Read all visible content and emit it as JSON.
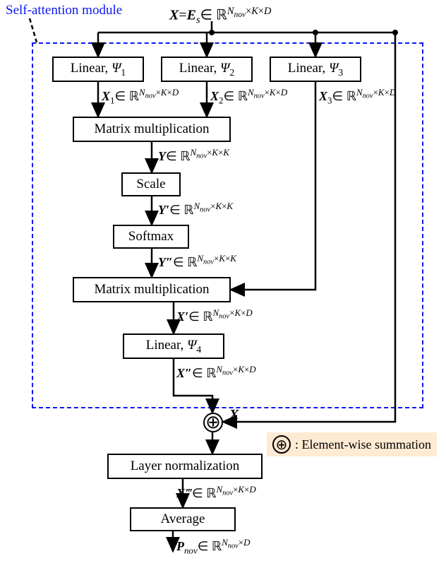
{
  "module_title": "Self-attention module",
  "input": {
    "lhs": "X",
    "rhs_var": "E",
    "rhs_sub": "s",
    "dims_sup": "N_nov×K×D"
  },
  "linear1": {
    "label_prefix": "Linear, ",
    "psi": "Ψ",
    "idx": "1"
  },
  "linear2": {
    "label_prefix": "Linear, ",
    "psi": "Ψ",
    "idx": "2"
  },
  "linear3": {
    "label_prefix": "Linear, ",
    "psi": "Ψ",
    "idx": "3"
  },
  "x1": {
    "var": "X",
    "idx": "1",
    "dims_sup": "N_nov×K×D"
  },
  "x2": {
    "var": "X",
    "idx": "2",
    "dims_sup": "N_nov×K×D"
  },
  "x3": {
    "var": "X",
    "idx": "3",
    "dims_sup": "N_nov×K×D"
  },
  "matmul1": "Matrix multiplication",
  "y": {
    "var": "Y",
    "dims_sup": "N_nov×K×K"
  },
  "scale": "Scale",
  "yp": {
    "var": "Y′",
    "dims_sup": "N_nov×K×K"
  },
  "softmax": "Softmax",
  "ypp": {
    "var": "Y″",
    "dims_sup": "N_nov×K×K"
  },
  "matmul2": "Matrix multiplication",
  "xp": {
    "var": "X′",
    "dims_sup": "N_nov×K×D"
  },
  "linear4": {
    "label_prefix": "Linear, ",
    "psi": "Ψ",
    "idx": "4"
  },
  "xpp": {
    "var": "X″",
    "dims_sup": "N_nov×K×D"
  },
  "residual_var": "X",
  "layernorm": "Layer normalization",
  "xppp": {
    "var": "X‴",
    "dims_sup": "N_nov×K×D"
  },
  "average": "Average",
  "output": {
    "var": "P",
    "sub_prefix": "nov",
    "dims_sup": "N_nov×D"
  },
  "legend": "Element-wise summation",
  "chart_data": {
    "type": "diagram",
    "title": "Self-attention module flow",
    "nodes": [
      {
        "id": "in",
        "label": "X = E_s ∈ ℝ^{N_nov×K×D}",
        "kind": "input"
      },
      {
        "id": "L1",
        "label": "Linear, Ψ1",
        "out": "X1 ∈ ℝ^{N_nov×K×D}"
      },
      {
        "id": "L2",
        "label": "Linear, Ψ2",
        "out": "X2 ∈ ℝ^{N_nov×K×D}"
      },
      {
        "id": "L3",
        "label": "Linear, Ψ3",
        "out": "X3 ∈ ℝ^{N_nov×K×D}"
      },
      {
        "id": "MM1",
        "label": "Matrix multiplication",
        "out": "Y ∈ ℝ^{N_nov×K×K}"
      },
      {
        "id": "SC",
        "label": "Scale",
        "out": "Y′ ∈ ℝ^{N_nov×K×K}"
      },
      {
        "id": "SM",
        "label": "Softmax",
        "out": "Y″ ∈ ℝ^{N_nov×K×K}"
      },
      {
        "id": "MM2",
        "label": "Matrix multiplication",
        "out": "X′ ∈ ℝ^{N_nov×K×D}"
      },
      {
        "id": "L4",
        "label": "Linear, Ψ4",
        "out": "X″ ∈ ℝ^{N_nov×K×D}"
      },
      {
        "id": "ADD",
        "label": "⊕ (element-wise summation)"
      },
      {
        "id": "LN",
        "label": "Layer normalization",
        "out": "X‴ ∈ ℝ^{N_nov×K×D}"
      },
      {
        "id": "AV",
        "label": "Average",
        "out": "P_nov ∈ ℝ^{N_nov×D}"
      }
    ],
    "edges": [
      [
        "in",
        "L1"
      ],
      [
        "in",
        "L2"
      ],
      [
        "in",
        "L3"
      ],
      [
        "L1",
        "MM1"
      ],
      [
        "L2",
        "MM1"
      ],
      [
        "MM1",
        "SC"
      ],
      [
        "SC",
        "SM"
      ],
      [
        "SM",
        "MM2"
      ],
      [
        "L3",
        "MM2"
      ],
      [
        "MM2",
        "L4"
      ],
      [
        "L4",
        "ADD"
      ],
      [
        "in",
        "ADD"
      ],
      [
        "ADD",
        "LN"
      ],
      [
        "LN",
        "AV"
      ]
    ],
    "module_box_contains": [
      "L1",
      "L2",
      "L3",
      "MM1",
      "SC",
      "SM",
      "MM2",
      "L4"
    ]
  }
}
